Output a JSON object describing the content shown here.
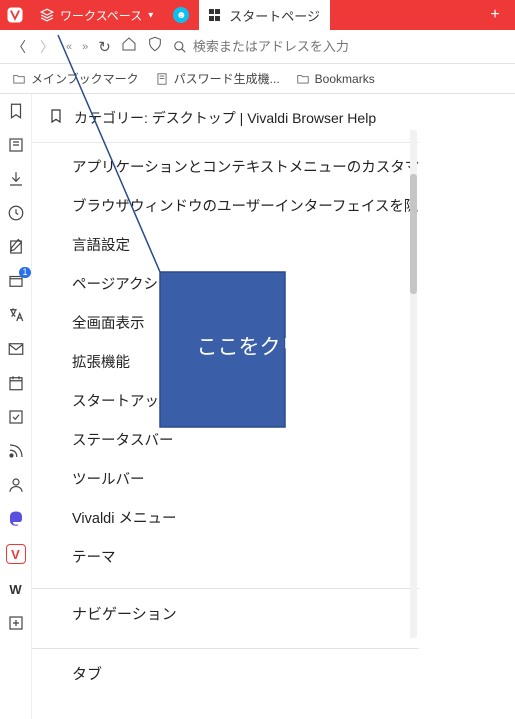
{
  "tabbar": {
    "workspace_label": "ワークスペース",
    "tab_label": "スタートページ",
    "newtab_glyph": "+"
  },
  "addr": {
    "placeholder": "検索またはアドレスを入力"
  },
  "bookmarks": {
    "main": "メインブックマーク",
    "pw": "パスワード生成機...",
    "folder": "Bookmarks"
  },
  "panel": {
    "title": "カテゴリー: デスクトップ | Vivaldi Browser Help",
    "close": "×"
  },
  "items": {
    "i0": "アプリケーションとコンテキストメニューのカスタマイズ",
    "i1": "ブラウザウィンドウのユーザーインターフェイスを隠す",
    "i2": "言語設定",
    "i3": "ページアクション",
    "i4": "全画面表示",
    "i5": "拡張機能",
    "i6": "スタートアップ",
    "i7": "ステータスバー",
    "i8": "ツールバー",
    "i9": "Vivaldi メニュー",
    "i10": "テーマ"
  },
  "accordion": {
    "nav": "ナビゲーション",
    "tab": "タブ"
  },
  "callout": {
    "text": "ここをクリック"
  },
  "sidepanel_badge": "1"
}
